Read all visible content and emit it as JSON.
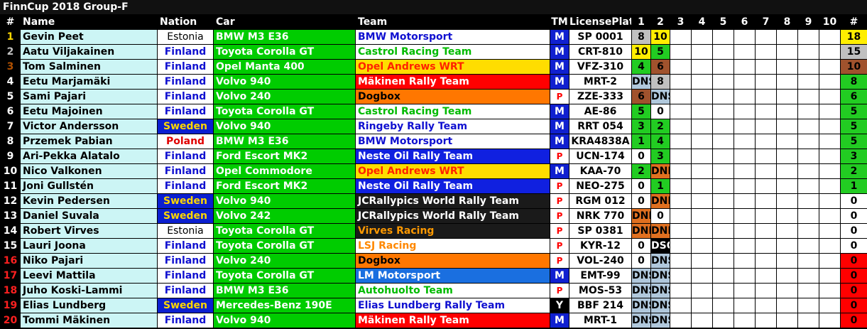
{
  "title": "FinnCup 2018 Group-F",
  "headers": {
    "pos": "#",
    "name": "Name",
    "nation": "Nation",
    "car": "Car",
    "team": "Team",
    "tm": "TM",
    "plate": "LicensePlate",
    "races": [
      "1",
      "2",
      "3",
      "4",
      "5",
      "6",
      "7",
      "8",
      "9",
      "10"
    ],
    "total": "#"
  },
  "colors": {
    "name_bg": "#ccf5f5",
    "car_bg": "#00cc00",
    "plate_bg": "#ffffff",
    "pos_gold": "#ffd700",
    "pos_silver": "#c0c0c0",
    "pos_bronze": "#b05000",
    "pos_red": "#ff2020"
  },
  "rows": [
    {
      "pos": "1",
      "name": "Gevin Peet",
      "nation": "Estonia",
      "car": "BMW M3 E36",
      "team": "BMW Motorsport",
      "tm": "M",
      "plate": "SP 0001",
      "r1": "8",
      "r2": "10",
      "total": "18",
      "posColor": "#ffd700",
      "teamBg": "#ffffff",
      "teamFg": "#1010d0",
      "r1Bg": "#c0c0c0",
      "r1Fg": "#000",
      "r2Bg": "#ffee00",
      "r2Fg": "#000",
      "totBg": "#ffee00",
      "totFg": "#000"
    },
    {
      "pos": "2",
      "name": "Aatu Viljakainen",
      "nation": "Finland",
      "car": "Toyota Corolla GT",
      "team": "Castrol Racing Team",
      "tm": "M",
      "plate": "CRT-810",
      "r1": "10",
      "r2": "5",
      "total": "15",
      "posColor": "#c0c0c0",
      "teamBg": "#ffffff",
      "teamFg": "#00bb00",
      "r1Bg": "#ffee00",
      "r1Fg": "#000",
      "r2Bg": "#22cc22",
      "r2Fg": "#000",
      "totBg": "#c0c0c0",
      "totFg": "#000"
    },
    {
      "pos": "3",
      "name": "Tom Salminen",
      "nation": "Finland",
      "car": "Opel Manta 400",
      "team": "Opel Andrews WRT",
      "tm": "M",
      "plate": "VFZ-310",
      "r1": "4",
      "r2": "6",
      "total": "10",
      "posColor": "#b05000",
      "teamBg": "#ffdd00",
      "teamFg": "#ff2200",
      "r1Bg": "#22cc22",
      "r1Fg": "#000",
      "r2Bg": "#a0522d",
      "r2Fg": "#000",
      "totBg": "#a0522d",
      "totFg": "#000"
    },
    {
      "pos": "4",
      "name": "Eetu Marjamäki",
      "nation": "Finland",
      "car": "Volvo 940",
      "team": "Mäkinen Rally Team",
      "tm": "M",
      "plate": "MRT-2",
      "r1": "DNS",
      "r2": "8",
      "total": "8",
      "posColor": "#ffffff",
      "teamBg": "#ff0000",
      "teamFg": "#ffffff",
      "r1Bg": "#b0c8dc",
      "r1Fg": "#000",
      "r2Bg": "#c0c0c0",
      "r2Fg": "#000",
      "totBg": "#22cc22",
      "totFg": "#000"
    },
    {
      "pos": "5",
      "name": "Sami Pajari",
      "nation": "Finland",
      "car": "Volvo 240",
      "team": "Dogbox",
      "tm": "P",
      "plate": "ZZE-333",
      "r1": "6",
      "r2": "DNS",
      "total": "6",
      "posColor": "#ffffff",
      "teamBg": "#ff7700",
      "teamFg": "#000000",
      "r1Bg": "#a0522d",
      "r1Fg": "#000",
      "r2Bg": "#b0c8dc",
      "r2Fg": "#000",
      "totBg": "#22cc22",
      "totFg": "#000"
    },
    {
      "pos": "6",
      "name": "Eetu Majoinen",
      "nation": "Finland",
      "car": "Toyota Corolla GT",
      "team": "Castrol Racing Team",
      "tm": "M",
      "plate": "AE-86",
      "r1": "5",
      "r2": "0",
      "total": "5",
      "posColor": "#ffffff",
      "teamBg": "#ffffff",
      "teamFg": "#00bb00",
      "r1Bg": "#22cc22",
      "r1Fg": "#000",
      "r2Bg": "#ffffff",
      "r2Fg": "#000",
      "totBg": "#22cc22",
      "totFg": "#000"
    },
    {
      "pos": "7",
      "name": "Victor Andersson",
      "nation": "Sweden",
      "car": "Volvo 940",
      "team": "Ringeby Rally Team",
      "tm": "M",
      "plate": "RRT 054",
      "r1": "3",
      "r2": "2",
      "total": "5",
      "posColor": "#ffffff",
      "teamBg": "#ffffff",
      "teamFg": "#1010d0",
      "r1Bg": "#22cc22",
      "r1Fg": "#000",
      "r2Bg": "#22cc22",
      "r2Fg": "#000",
      "totBg": "#22cc22",
      "totFg": "#000"
    },
    {
      "pos": "8",
      "name": "Przemek Pabian",
      "nation": "Poland",
      "car": "BMW M3 E36",
      "team": "BMW Motorsport",
      "tm": "M",
      "plate": "KRA4838A",
      "r1": "1",
      "r2": "4",
      "total": "5",
      "posColor": "#ffffff",
      "teamBg": "#ffffff",
      "teamFg": "#1010d0",
      "r1Bg": "#22cc22",
      "r1Fg": "#000",
      "r2Bg": "#22cc22",
      "r2Fg": "#000",
      "totBg": "#22cc22",
      "totFg": "#000"
    },
    {
      "pos": "9",
      "name": "Ari-Pekka Alatalo",
      "nation": "Finland",
      "car": "Ford Escort MK2",
      "team": "Neste Oil Rally Team",
      "tm": "P",
      "plate": "UCN-174",
      "r1": "0",
      "r2": "3",
      "total": "3",
      "posColor": "#ffffff",
      "teamBg": "#1020e0",
      "teamFg": "#ffffff",
      "r1Bg": "#ffffff",
      "r1Fg": "#000",
      "r2Bg": "#22cc22",
      "r2Fg": "#000",
      "totBg": "#22cc22",
      "totFg": "#000"
    },
    {
      "pos": "10",
      "name": "Nico Valkonen",
      "nation": "Finland",
      "car": "Opel Commodore",
      "team": "Opel Andrews WRT",
      "tm": "M",
      "plate": "KAA-70",
      "r1": "2",
      "r2": "DNF",
      "total": "2",
      "posColor": "#ffffff",
      "teamBg": "#ffdd00",
      "teamFg": "#ff2200",
      "r1Bg": "#22cc22",
      "r1Fg": "#000",
      "r2Bg": "#e07020",
      "r2Fg": "#000",
      "totBg": "#22cc22",
      "totFg": "#000"
    },
    {
      "pos": "11",
      "name": "Joni Gullstén",
      "nation": "Finland",
      "car": "Ford Escort MK2",
      "team": "Neste Oil Rally Team",
      "tm": "P",
      "plate": "NEO-275",
      "r1": "0",
      "r2": "1",
      "total": "1",
      "posColor": "#ffffff",
      "teamBg": "#1020e0",
      "teamFg": "#ffffff",
      "r1Bg": "#ffffff",
      "r1Fg": "#000",
      "r2Bg": "#22cc22",
      "r2Fg": "#000",
      "totBg": "#22cc22",
      "totFg": "#000"
    },
    {
      "pos": "12",
      "name": "Kevin Pedersen",
      "nation": "Sweden",
      "car": "Volvo 940",
      "team": "JCRallypics World Rally Team",
      "tm": "P",
      "plate": "RGM 012",
      "r1": "0",
      "r2": "DNF",
      "total": "0",
      "posColor": "#ffffff",
      "teamBg": "#1a1a1a",
      "teamFg": "#ffffff",
      "r1Bg": "#ffffff",
      "r1Fg": "#000",
      "r2Bg": "#e07020",
      "r2Fg": "#000",
      "totBg": "#ffffff",
      "totFg": "#000"
    },
    {
      "pos": "13",
      "name": "Daniel Suvala",
      "nation": "Sweden",
      "car": "Volvo 242",
      "team": "JCRallypics World Rally Team",
      "tm": "P",
      "plate": "NRK 770",
      "r1": "DNF",
      "r2": "0",
      "total": "0",
      "posColor": "#ffffff",
      "teamBg": "#1a1a1a",
      "teamFg": "#ffffff",
      "r1Bg": "#e07020",
      "r1Fg": "#000",
      "r2Bg": "#ffffff",
      "r2Fg": "#000",
      "totBg": "#ffffff",
      "totFg": "#000"
    },
    {
      "pos": "14",
      "name": "Robert Virves",
      "nation": "Estonia",
      "car": "Toyota Corolla GT",
      "team": "Virves Racing",
      "tm": "P",
      "plate": "SP 0381",
      "r1": "DNF",
      "r2": "DNF",
      "total": "0",
      "posColor": "#ffffff",
      "teamBg": "#1a1a1a",
      "teamFg": "#ff9900",
      "r1Bg": "#e07020",
      "r1Fg": "#000",
      "r2Bg": "#e07020",
      "r2Fg": "#000",
      "totBg": "#ffffff",
      "totFg": "#000"
    },
    {
      "pos": "15",
      "name": "Lauri Joona",
      "nation": "Finland",
      "car": "Toyota Corolla GT",
      "team": "LSJ Racing",
      "tm": "P",
      "plate": "KYR-12",
      "r1": "0",
      "r2": "DSQ",
      "total": "0",
      "posColor": "#ffffff",
      "teamBg": "#ffffff",
      "teamFg": "#ff8800",
      "r1Bg": "#ffffff",
      "r1Fg": "#000",
      "r2Bg": "#000000",
      "r2Fg": "#fff",
      "totBg": "#ffffff",
      "totFg": "#000"
    },
    {
      "pos": "16",
      "name": "Niko Pajari",
      "nation": "Finland",
      "car": "Volvo 240",
      "team": "Dogbox",
      "tm": "P",
      "plate": "VOL-240",
      "r1": "0",
      "r2": "DNS",
      "total": "0",
      "posColor": "#ff2020",
      "teamBg": "#ff7700",
      "teamFg": "#000000",
      "r1Bg": "#ffffff",
      "r1Fg": "#000",
      "r2Bg": "#b0c8dc",
      "r2Fg": "#000",
      "totBg": "#ff0000",
      "totFg": "#000"
    },
    {
      "pos": "17",
      "name": "Leevi Mattila",
      "nation": "Finland",
      "car": "Toyota Corolla GT",
      "team": "LM Motorsport",
      "tm": "M",
      "plate": "EMT-99",
      "r1": "DNS",
      "r2": "DNS",
      "total": "0",
      "posColor": "#ff2020",
      "teamBg": "#1a6fe0",
      "teamFg": "#ffffff",
      "r1Bg": "#b0c8dc",
      "r1Fg": "#000",
      "r2Bg": "#b0c8dc",
      "r2Fg": "#000",
      "totBg": "#ff0000",
      "totFg": "#000"
    },
    {
      "pos": "18",
      "name": "Juho Koski-Lammi",
      "nation": "Finland",
      "car": "BMW M3 E36",
      "team": "Autohuolto Team",
      "tm": "P",
      "plate": "MOS-53",
      "r1": "DNS",
      "r2": "DNS",
      "total": "0",
      "posColor": "#ff2020",
      "teamBg": "#ffffff",
      "teamFg": "#00bb00",
      "r1Bg": "#b0c8dc",
      "r1Fg": "#000",
      "r2Bg": "#b0c8dc",
      "r2Fg": "#000",
      "totBg": "#ff0000",
      "totFg": "#000"
    },
    {
      "pos": "19",
      "name": "Elias Lundberg",
      "nation": "Sweden",
      "car": "Mercedes-Benz 190E",
      "team": "Elias Lundberg Rally Team",
      "tm": "Y",
      "plate": "BBF 214",
      "r1": "DNS",
      "r2": "DNS",
      "total": "0",
      "posColor": "#ff2020",
      "teamBg": "#ffffff",
      "teamFg": "#1010d0",
      "r1Bg": "#b0c8dc",
      "r1Fg": "#000",
      "r2Bg": "#b0c8dc",
      "r2Fg": "#000",
      "totBg": "#ff0000",
      "totFg": "#000"
    },
    {
      "pos": "20",
      "name": "Tommi Mäkinen",
      "nation": "Finland",
      "car": "Volvo 940",
      "team": "Mäkinen Rally Team",
      "tm": "M",
      "plate": "MRT-1",
      "r1": "DNS",
      "r2": "DNS",
      "total": "0",
      "posColor": "#ff2020",
      "teamBg": "#ff0000",
      "teamFg": "#ffffff",
      "r1Bg": "#b0c8dc",
      "r1Fg": "#000",
      "r2Bg": "#b0c8dc",
      "r2Fg": "#000",
      "totBg": "#ff0000",
      "totFg": "#000"
    }
  ]
}
